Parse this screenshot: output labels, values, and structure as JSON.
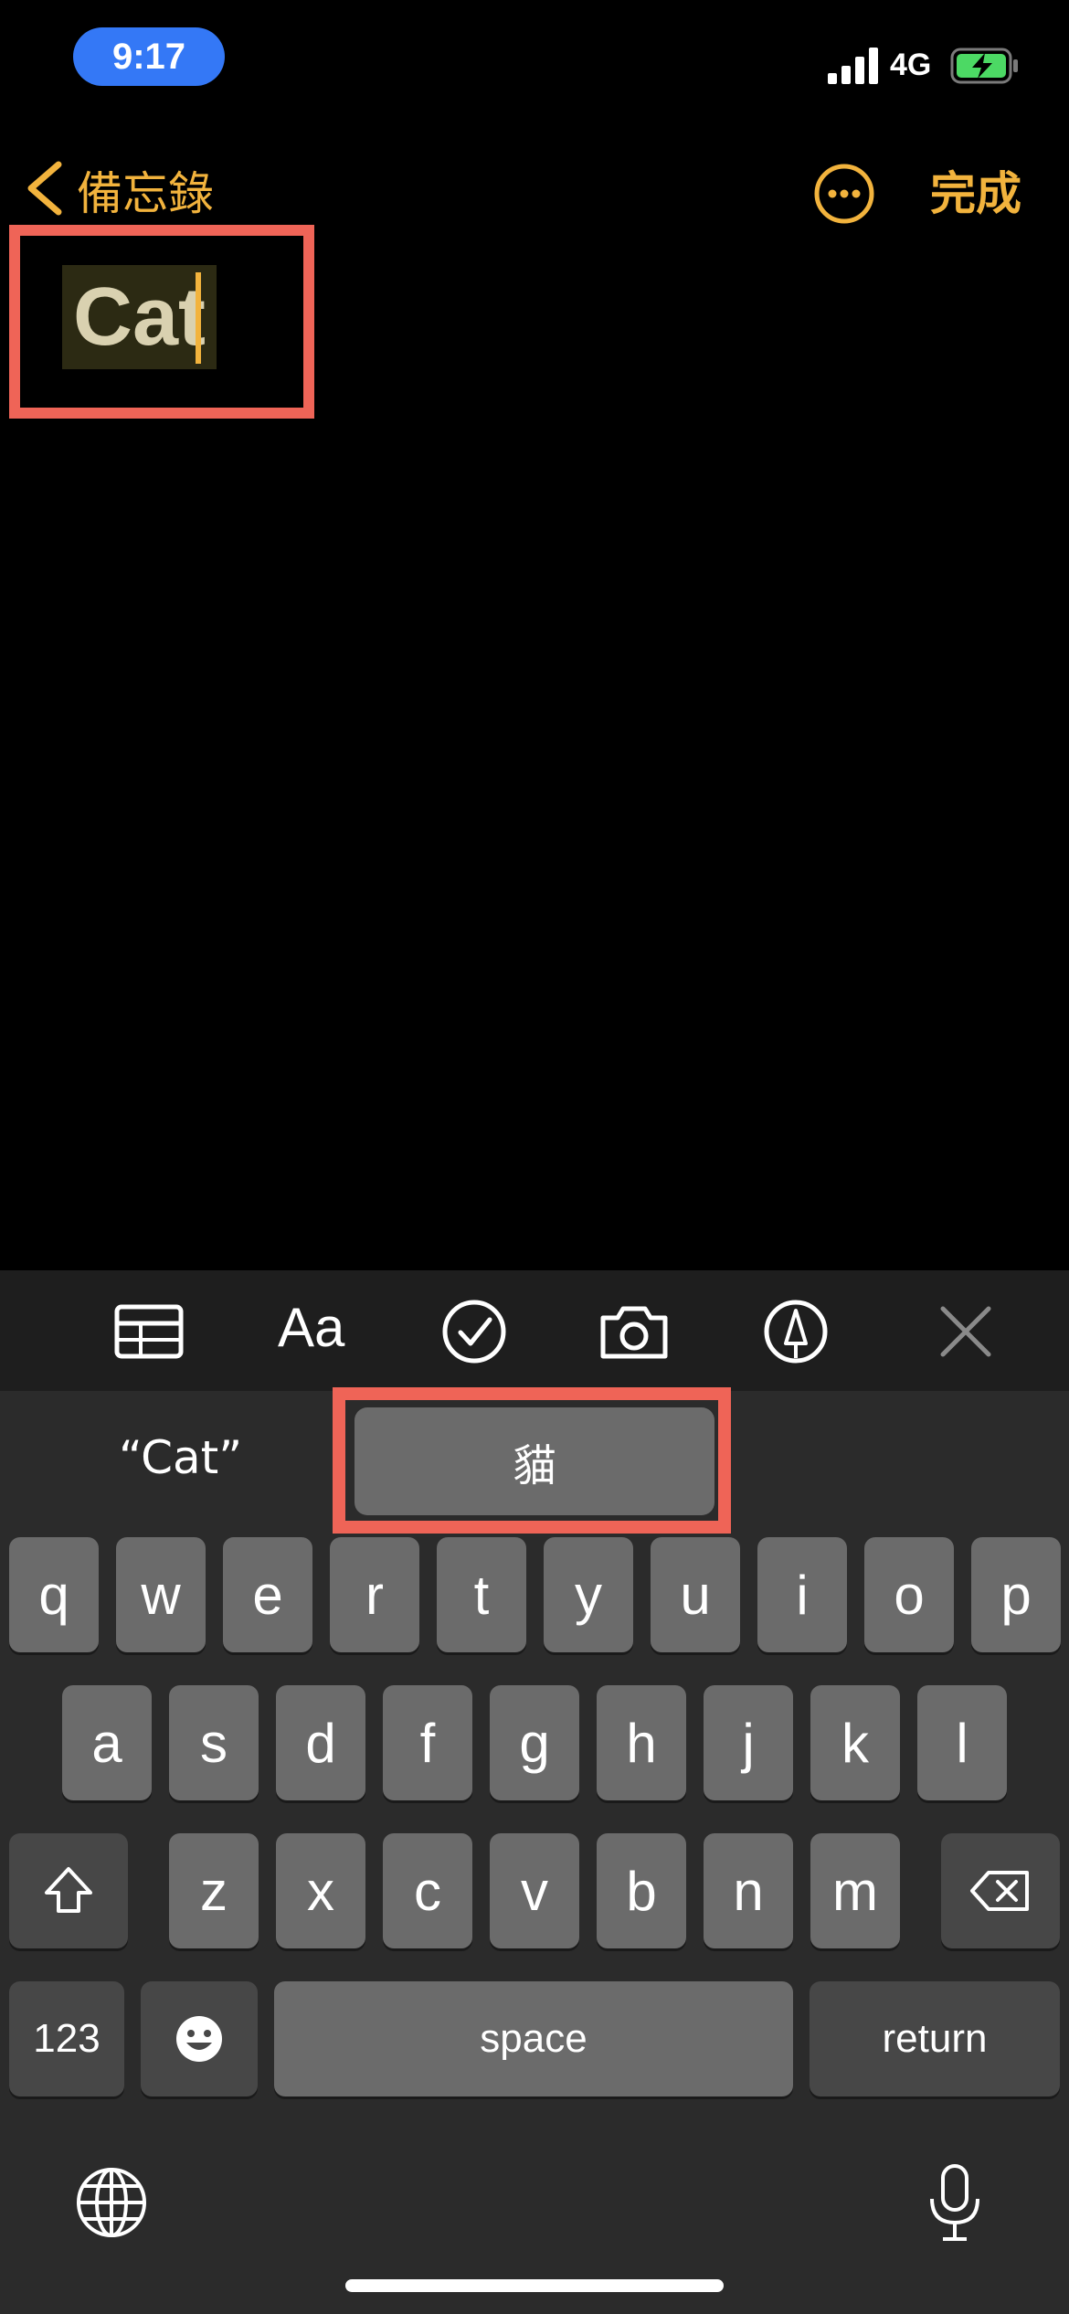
{
  "status": {
    "time": "9:17",
    "network": "4G"
  },
  "nav": {
    "back_label": "備忘錄",
    "done_label": "完成"
  },
  "note": {
    "title": "Cat"
  },
  "suggestions": {
    "left": "“Cat”",
    "center": "貓"
  },
  "keyboard": {
    "row1": [
      "q",
      "w",
      "e",
      "r",
      "t",
      "y",
      "u",
      "i",
      "o",
      "p"
    ],
    "row2": [
      "a",
      "s",
      "d",
      "f",
      "g",
      "h",
      "j",
      "k",
      "l"
    ],
    "row3": [
      "z",
      "x",
      "c",
      "v",
      "b",
      "n",
      "m"
    ],
    "numbers": "123",
    "space": "space",
    "return": "return"
  },
  "toolbar": {
    "format_label": "Aa"
  },
  "colors": {
    "accent": "#f2b33d",
    "highlight": "#ef6457",
    "time_pill": "#3478f6"
  }
}
